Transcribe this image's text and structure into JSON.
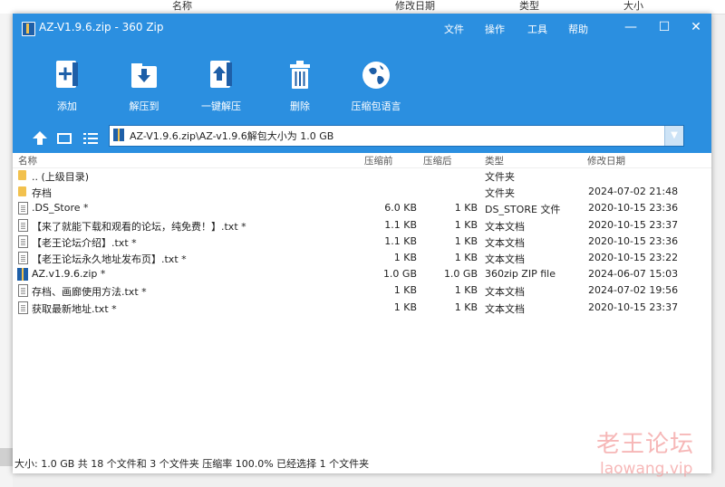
{
  "background_header": {
    "name": "名称",
    "modified": "修改日期",
    "type": "类型",
    "size": "大小"
  },
  "window": {
    "title": "AZ-V1.9.6.zip - 360 Zip",
    "menus": [
      "文件",
      "操作",
      "工具",
      "帮助"
    ],
    "controls": {
      "minimize": "—",
      "maximize": "☐",
      "close": "✕"
    }
  },
  "toolbar": {
    "add": "添加",
    "extract_to": "解压到",
    "one_click_extract": "一键解压",
    "delete": "删除",
    "language": "压缩包语言"
  },
  "path": {
    "value": "AZ-V1.9.6.zip\\AZ-v1.9.6解包大小为 1.0 GB"
  },
  "columns": {
    "name": "名称",
    "compressed": "压缩前",
    "packed": "压缩后",
    "type": "类型",
    "modified": "修改日期"
  },
  "files": [
    {
      "icon": "folder-up-icon",
      "name": ".. (上级目录)",
      "size": "",
      "packed": "",
      "type": "文件夹",
      "modified": ""
    },
    {
      "icon": "folder-icon",
      "name": "存档",
      "size": "",
      "packed": "",
      "type": "文件夹",
      "modified": "2024-07-02 21:48"
    },
    {
      "icon": "file-icon",
      "name": ".DS_Store *",
      "size": "6.0 KB",
      "packed": "1 KB",
      "type": "DS_STORE 文件",
      "modified": "2020-10-15 23:36"
    },
    {
      "icon": "text-file-icon",
      "name": "【来了就能下载和观看的论坛，纯免费！】.txt *",
      "size": "1.1 KB",
      "packed": "1 KB",
      "type": "文本文档",
      "modified": "2020-10-15 23:37"
    },
    {
      "icon": "text-file-icon",
      "name": "【老王论坛介绍】.txt *",
      "size": "1.1 KB",
      "packed": "1 KB",
      "type": "文本文档",
      "modified": "2020-10-15 23:36"
    },
    {
      "icon": "text-file-icon",
      "name": "【老王论坛永久地址发布页】.txt *",
      "size": "1 KB",
      "packed": "1 KB",
      "type": "文本文档",
      "modified": "2020-10-15 23:22"
    },
    {
      "icon": "zip-file-icon",
      "name": "AZ.v1.9.6.zip *",
      "size": "1.0 GB",
      "packed": "1.0 GB",
      "type": "360zip ZIP file",
      "modified": "2024-06-07 15:03"
    },
    {
      "icon": "text-file-icon",
      "name": "存档、画廊使用方法.txt *",
      "size": "1 KB",
      "packed": "1 KB",
      "type": "文本文档",
      "modified": "2024-07-02 19:56"
    },
    {
      "icon": "text-file-icon",
      "name": "获取最新地址.txt *",
      "size": "1 KB",
      "packed": "1 KB",
      "type": "文本文档",
      "modified": "2020-10-15 23:37"
    }
  ],
  "status": {
    "text": "大小: 1.0 GB 共 18 个文件和 3 个文件夹 压缩率 100.0% 已经选择 1 个文件夹"
  },
  "watermark": {
    "line1": "老王论坛",
    "line2": "laowang.vip"
  },
  "colors": {
    "accent": "#2b8fe0",
    "folder": "#f2c14e"
  }
}
